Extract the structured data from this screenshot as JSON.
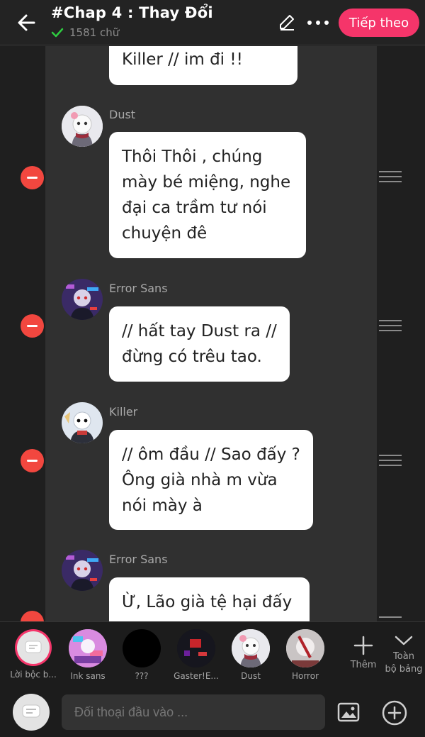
{
  "header": {
    "title": "#Chap 4 : Thay Đổi",
    "word_count": "1581 chữ",
    "next_label": "Tiếp theo"
  },
  "messages": [
    {
      "character": "",
      "text_lines": [
        "Killer // im đi !!"
      ]
    },
    {
      "character": "Dust",
      "text_lines": [
        "Thôi Thôi , chúng",
        "mày bé miệng, nghe",
        "đại ca trầm tư nói",
        "chuyện đê"
      ]
    },
    {
      "character": "Error Sans",
      "text_lines": [
        "// hất tay Dust ra //",
        "đừng có trêu tao."
      ]
    },
    {
      "character": "Killer",
      "text_lines": [
        "// ôm đầu // Sao đấy ?",
        "Ông già nhà m vừa",
        "nói mày à"
      ]
    },
    {
      "character": "Error Sans",
      "text_lines": [
        "Ừ, Lão già tệ hại đấy"
      ]
    }
  ],
  "characters": [
    {
      "label": "Lời bộc b..."
    },
    {
      "label": "Ink sans"
    },
    {
      "label": "???"
    },
    {
      "label": "Gaster!E..."
    },
    {
      "label": "Dust"
    },
    {
      "label": "Horror"
    }
  ],
  "toolbar": {
    "add_label": "Thêm",
    "all_label_1": "Toàn",
    "all_label_2": "bộ bảng"
  },
  "input": {
    "placeholder": "Đối thoại đầu vào ..."
  },
  "colors": {
    "accent": "#f5356a",
    "delete": "#f2473f",
    "check": "#2ecc40"
  }
}
